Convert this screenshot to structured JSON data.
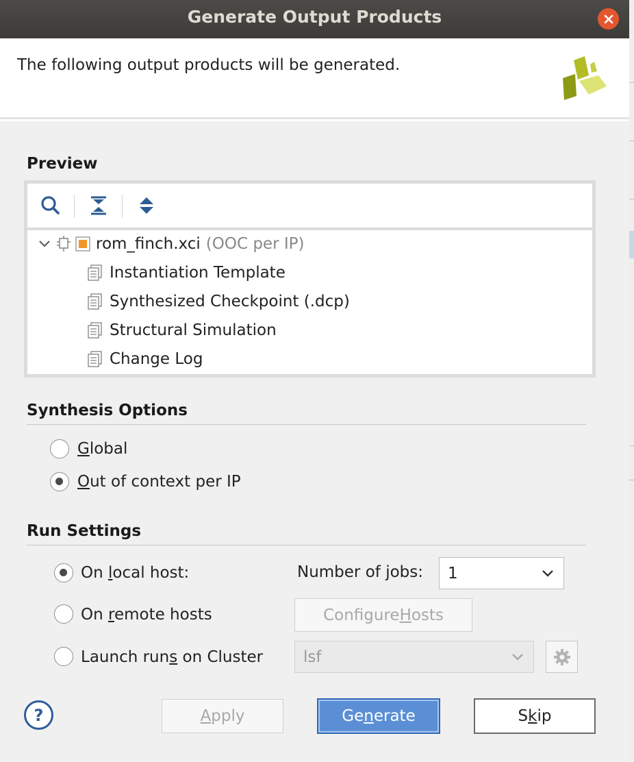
{
  "window": {
    "title": "Generate Output Products"
  },
  "header": {
    "message": "The following output products will be generated."
  },
  "preview": {
    "section_title": "Preview",
    "tree": {
      "root": {
        "name": "rom_finch.xci",
        "suffix": "(OOC per IP)"
      },
      "children": [
        "Instantiation Template",
        "Synthesized Checkpoint (.dcp)",
        "Structural Simulation",
        "Change Log"
      ]
    }
  },
  "synthesis": {
    "section_title": "Synthesis Options",
    "options": [
      {
        "pre": "",
        "mn": "G",
        "post": "lobal",
        "selected": false
      },
      {
        "pre": "",
        "mn": "O",
        "post": "ut of context per IP",
        "selected": true
      }
    ]
  },
  "run": {
    "section_title": "Run Settings",
    "options": [
      {
        "pre": "On ",
        "mn": "l",
        "post": "ocal host:",
        "selected": true
      },
      {
        "pre": "On ",
        "mn": "r",
        "post": "emote hosts",
        "selected": false
      },
      {
        "pre": "Launch run",
        "mn": "s",
        "post": " on Cluster",
        "selected": false
      }
    ],
    "jobs": {
      "label_pre": "Number of ",
      "label_mn": "j",
      "label_post": "obs:",
      "value": "1"
    },
    "configure_hosts": {
      "pre": "Configure ",
      "mn": "H",
      "post": "osts"
    },
    "cluster_value": "lsf"
  },
  "footer": {
    "help": "?",
    "apply": {
      "pre": "",
      "mn": "A",
      "post": "pply"
    },
    "generate": {
      "pre": "Ge",
      "mn": "n",
      "post": "erate"
    },
    "skip": {
      "pre": "S",
      "mn": "k",
      "post": "ip"
    }
  }
}
